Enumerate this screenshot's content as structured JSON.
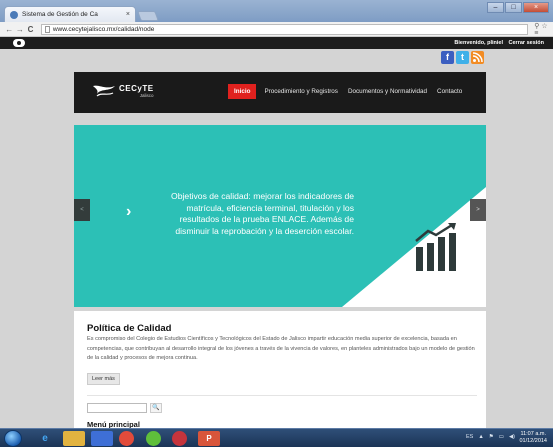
{
  "browser": {
    "tab_title": "Sistema de Gestión de Ca",
    "tab_close": "×",
    "url": "www.cecytejalisco.mx/calidad/node",
    "window_controls": [
      "–",
      "□",
      "×"
    ],
    "nav": {
      "back": "←",
      "forward": "→",
      "reload": "C"
    },
    "toolbar_right": "⚲ ☆ ≡"
  },
  "site": {
    "admin_bar": {
      "greeting": "Bienvenido, pliniel",
      "logout": "Cerrar sesión"
    },
    "social": [
      "f",
      "t",
      "rss"
    ],
    "logo": {
      "name": "CECyTE",
      "sub": "Jalisco"
    },
    "nav_items": [
      "Inicio",
      "Procedimiento y Registros",
      "Documentos y Normatividad",
      "Contacto"
    ],
    "slider": {
      "text": "Objetivos de calidad: mejorar los indicadores de matrícula, eficiencia terminal, titulación y los resultados de la prueba ENLACE. Además de disminuir la reprobación y la deserción escolar.",
      "prev": "<",
      "next": ">",
      "chevron": "›"
    },
    "content": {
      "title": "Política de Calidad",
      "body": "Es compromiso del Colegio de Estudios Científicos y Tecnológicos del Estado de Jalisco impartir educación media superior de excelencia, basada en competencias, que contribuyan al desarrollo integral de los jóvenes a través de la vivencia de valores, en planteles administrados bajo un modelo de gestión de la calidad y procesos de mejora continua.",
      "read_more": "Leer más",
      "search_button": "🔍",
      "menu_title": "Menú principal"
    }
  },
  "taskbar": {
    "tray_text": [
      "ES",
      "▲",
      "⚑",
      "▭",
      "◀)"
    ],
    "time": "11:07 a.m.",
    "date": "01/12/2014"
  },
  "colors": {
    "accent": "#e0211e",
    "slider_bg": "#2cc0b6",
    "header_bg": "#1a1a1a"
  }
}
